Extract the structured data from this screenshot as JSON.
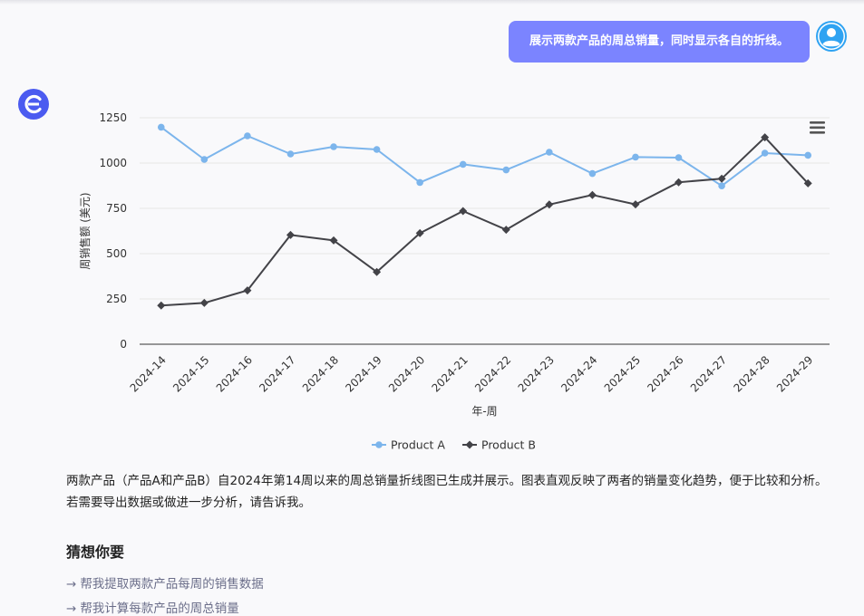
{
  "conversation": {
    "user_message": "展示两款产品的周总销量，同时显示各自的折线。",
    "answer_text": "两款产品（产品A和产品B）自2024年第14周以来的周总销量折线图已生成并展示。图表直观反映了两者的销量变化趋势，便于比较和分析。若需要导出数据或做进一步分析，请告诉我。",
    "suggest_title": "猜想你要",
    "suggestions": [
      {
        "arrow": "→",
        "label": "帮我提取两款产品每周的销售数据"
      },
      {
        "arrow": "→",
        "label": "帮我计算每款产品的周总销量"
      }
    ]
  },
  "icons": {
    "user_avatar": "user-avatar-icon",
    "bot_avatar": "assistant-logo-icon",
    "chart_menu": "hamburger-menu-icon"
  },
  "colors": {
    "user_bubble": "#7b84ff",
    "bot_logo": "#4b5bf0",
    "user_avatar": "#2fa3f2",
    "series_a": "#7cb5ec",
    "series_b": "#434348"
  },
  "chart_data": {
    "type": "line",
    "xlabel": "年-周",
    "ylabel": "周销售额 (美元)",
    "categories": [
      "2024-14",
      "2024-15",
      "2024-16",
      "2024-17",
      "2024-18",
      "2024-19",
      "2024-20",
      "2024-21",
      "2024-22",
      "2024-23",
      "2024-24",
      "2024-25",
      "2024-26",
      "2024-27",
      "2024-28",
      "2024-29"
    ],
    "ylim": [
      0,
      1250
    ],
    "yticks": [
      "0",
      "250",
      "500",
      "750",
      "1000",
      "1250"
    ],
    "grid": true,
    "legend": "bottom-center",
    "series": [
      {
        "name": "Product A",
        "marker": "circle",
        "values": [
          1198,
          1020,
          1150,
          1050,
          1090,
          1075,
          893,
          993,
          962,
          1060,
          942,
          1033,
          1030,
          874,
          1055,
          1043
        ]
      },
      {
        "name": "Product B",
        "marker": "diamond",
        "values": [
          214,
          228,
          297,
          603,
          573,
          399,
          613,
          735,
          632,
          771,
          824,
          772,
          894,
          914,
          1142,
          888
        ]
      }
    ]
  }
}
